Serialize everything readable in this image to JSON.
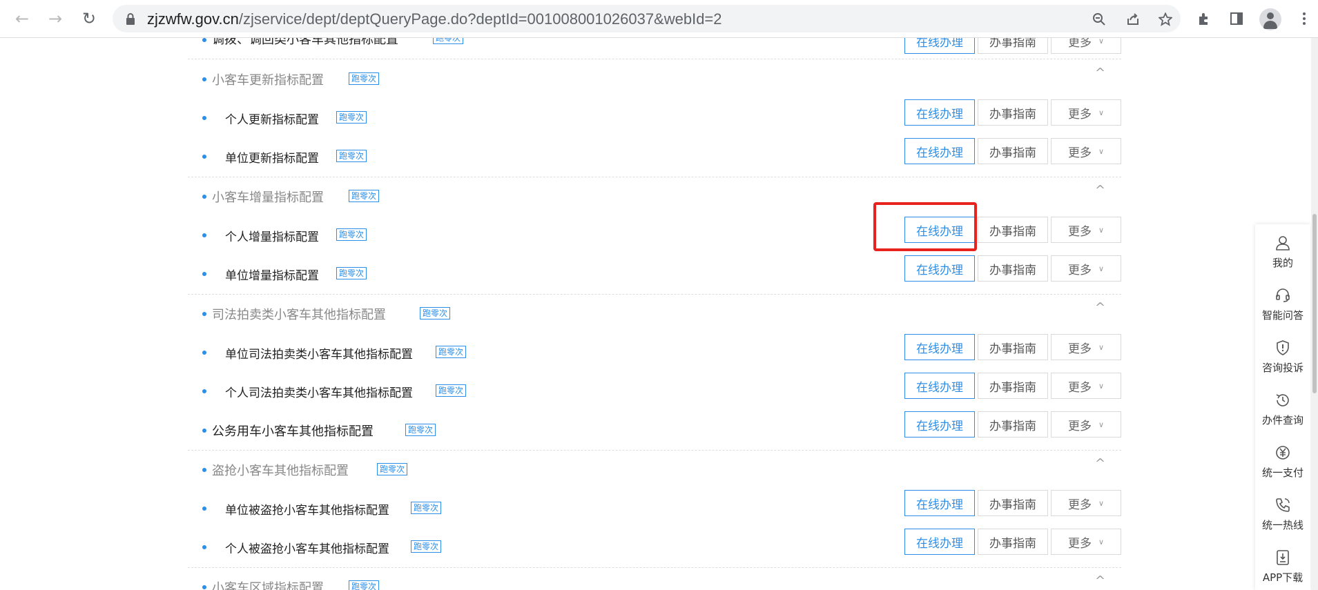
{
  "browser": {
    "url_host": "zjzwfw.gov.cn",
    "url_path": "/zjservice/dept/deptQueryPage.do?deptId=001008001026037&webId=2",
    "icons": [
      "back-icon",
      "forward-icon",
      "reload-icon",
      "lock-icon",
      "zoom-icon",
      "share-icon",
      "star-icon",
      "extensions-icon",
      "sidepanel-icon",
      "profile-icon",
      "menu-icon"
    ]
  },
  "labels": {
    "online": "在线办理",
    "guide": "办事指南",
    "more": "更多",
    "badge": "跑零次",
    "caret": "^"
  },
  "rows": [
    {
      "kind": "cat-partial",
      "title": "调拨、调回类小客车其他指标配置"
    },
    {
      "kind": "cat",
      "title": "小客车更新指标配置"
    },
    {
      "kind": "item",
      "title": "个人更新指标配置"
    },
    {
      "kind": "item",
      "title": "单位更新指标配置"
    },
    {
      "kind": "cat",
      "title": "小客车增量指标配置"
    },
    {
      "kind": "item",
      "title": "个人增量指标配置"
    },
    {
      "kind": "item",
      "title": "单位增量指标配置"
    },
    {
      "kind": "cat",
      "title": "司法拍卖类小客车其他指标配置"
    },
    {
      "kind": "item",
      "title": "单位司法拍卖类小客车其他指标配置"
    },
    {
      "kind": "item",
      "title": "个人司法拍卖类小客车其他指标配置"
    },
    {
      "kind": "top",
      "title": "公务用车小客车其他指标配置"
    },
    {
      "kind": "cat",
      "title": "盗抢小客车其他指标配置"
    },
    {
      "kind": "item",
      "title": "单位被盗抢小客车其他指标配置"
    },
    {
      "kind": "item",
      "title": "个人被盗抢小客车其他指标配置"
    },
    {
      "kind": "cat-partial",
      "title": "小客车区域指标配置"
    }
  ],
  "side_panel": [
    {
      "label": "我的",
      "icon": "user-icon"
    },
    {
      "label": "智能问答",
      "icon": "headset-icon"
    },
    {
      "label": "咨询投诉",
      "icon": "shield-alert-icon"
    },
    {
      "label": "办件查询",
      "icon": "history-icon"
    },
    {
      "label": "统一支付",
      "icon": "yuan-icon"
    },
    {
      "label": "统一热线",
      "icon": "phone-icon"
    },
    {
      "label": "APP下载",
      "icon": "download-icon"
    }
  ],
  "accent_color": "#2b8ee8",
  "highlight_color": "#e8221c"
}
